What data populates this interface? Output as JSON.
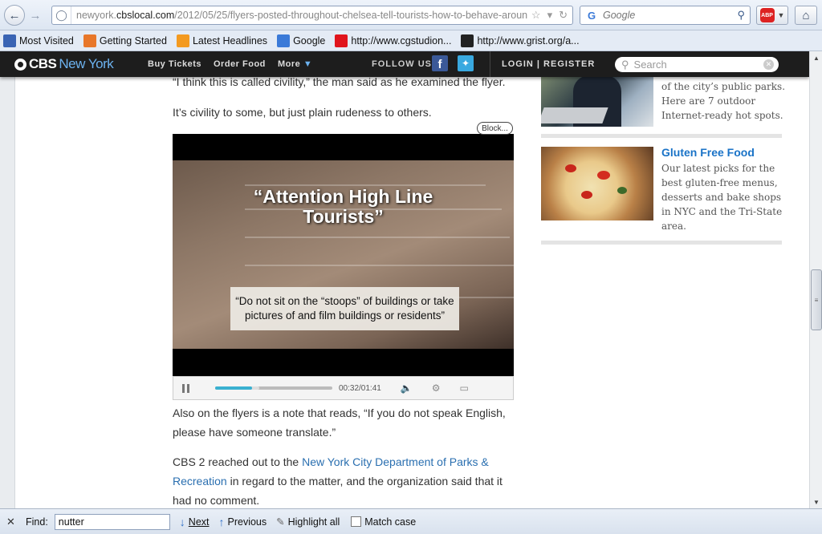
{
  "browser": {
    "url_prefix": "newyork.",
    "url_host": "cbslocal.com",
    "url_path": "/2012/05/25/flyers-posted-throughout-chelsea-tell-tourists-how-to-behave-aroun",
    "search_engine_label": "G",
    "search_placeholder": "Google",
    "abp_label": "ABP"
  },
  "bookmarks": [
    {
      "label": "Most Visited",
      "icon": "bookmark-icon",
      "color": "#3a64b4"
    },
    {
      "label": "Getting Started",
      "icon": "firefox-icon",
      "color": "#e8772a"
    },
    {
      "label": "Latest Headlines",
      "icon": "rss-icon",
      "color": "#f39a20"
    },
    {
      "label": "Google",
      "icon": "google-icon",
      "color": "#3b7ad8"
    },
    {
      "label": "http://www.cgstudion...",
      "icon": "red-square-icon",
      "color": "#e0141c"
    },
    {
      "label": "http://www.grist.org/a...",
      "icon": "grist-icon",
      "color": "#222222"
    }
  ],
  "site": {
    "logo_cbs": "CBS",
    "logo_ny": "New York",
    "nav": [
      "Buy Tickets",
      "Order Food",
      "More"
    ],
    "follow_label": "FOLLOW US",
    "login_label": "LOGIN",
    "register_label": "REGISTER",
    "search_placeholder": "Search"
  },
  "article": {
    "para1": "“I think this is called civility,” the man said as he examined the flyer.",
    "para2": "It’s civility to some, but just plain rudeness to others.",
    "para3": "Also on the flyers is a note that reads, “If you do not speak English, please have someone translate.”",
    "para4_pre": "CBS 2 reached out to the ",
    "para4_link": "New York City Department of Parks  & Recreation",
    "para4_post": " in regard to the matter, and the organization said that it had no comment.",
    "block_label": "Block..."
  },
  "video": {
    "headline_line1": "“Attention High Line",
    "headline_line2": "Tourists”",
    "caption": "“Do not sit on the “stoops” of buildings or take pictures of and film buildings or residents”",
    "timecode": "00:32/01:41",
    "progress_fraction": 0.317,
    "buffered_fraction": 0.38
  },
  "sidebar": {
    "promo1_text": "of the city’s public parks. Here are 7 outdoor Internet-ready hot spots.",
    "promo2_title": "Gluten Free Food",
    "promo2_text": "Our latest picks for the best gluten-free menus, desserts and bake shops in NYC and the Tri-State area."
  },
  "findbar": {
    "label": "Find:",
    "query": "nutter",
    "next_label": "Next",
    "previous_label": "Previous",
    "highlight_label": "Highlight all",
    "matchcase_label": "Match case"
  }
}
